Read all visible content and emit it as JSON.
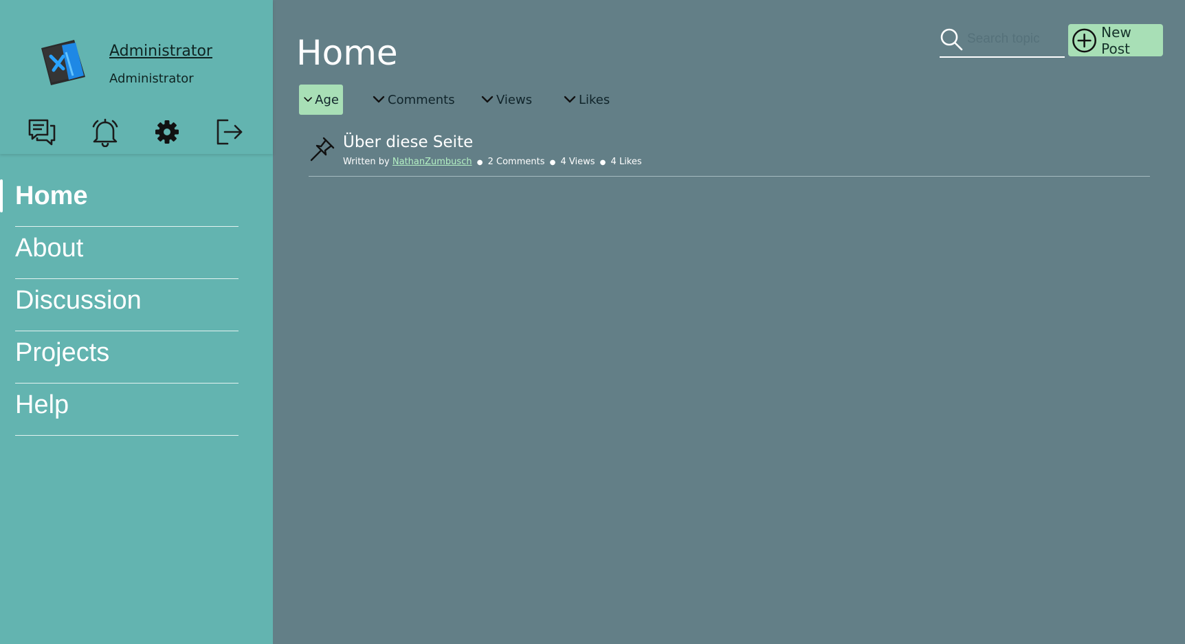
{
  "profile": {
    "name": "Administrator",
    "role": "Administrator",
    "icons": [
      "messages-icon",
      "bell-icon",
      "gear-icon",
      "logout-icon"
    ]
  },
  "nav": {
    "items": [
      {
        "label": "Home"
      },
      {
        "label": "About"
      },
      {
        "label": "Discussion"
      },
      {
        "label": "Projects"
      },
      {
        "label": "Help"
      }
    ],
    "active": "Home"
  },
  "main": {
    "title": "Home",
    "search_placeholder": "Search topic",
    "new_post_label": "New Post",
    "sort": {
      "options": [
        {
          "label": "Age"
        },
        {
          "label": "Comments"
        },
        {
          "label": "Views"
        },
        {
          "label": "Likes"
        }
      ],
      "active": "Age"
    },
    "topics": [
      {
        "title": "Über diese Seite",
        "written_by": "Written by",
        "author": "NathanZumbusch",
        "comments": "2 Comments",
        "views": "4 Views",
        "likes": "4 Likes",
        "pinned": true
      }
    ]
  },
  "colors": {
    "sidebar": "#63b4b0",
    "main_bg": "#637f87",
    "accent": "#a8dfb6",
    "link": "#b4f0c4"
  }
}
